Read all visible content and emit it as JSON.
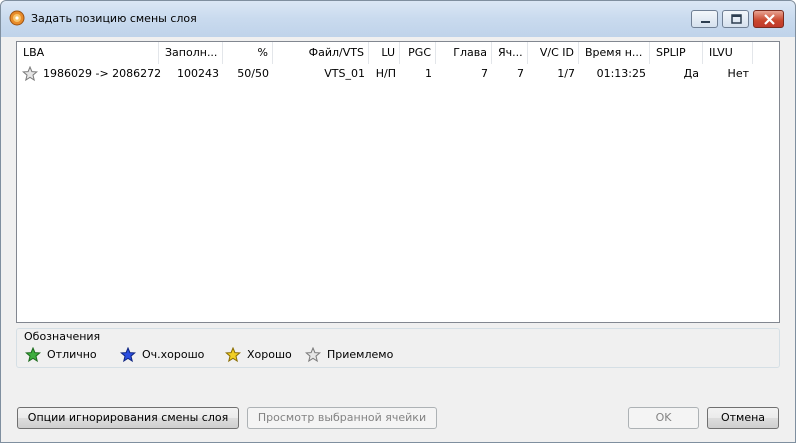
{
  "window": {
    "title": "Задать позицию смены слоя"
  },
  "list": {
    "columns": [
      {
        "label": "LBA"
      },
      {
        "label": "Заполн..."
      },
      {
        "label": "%"
      },
      {
        "label": "Файл/VTS"
      },
      {
        "label": "LU"
      },
      {
        "label": "PGC"
      },
      {
        "label": "Глава"
      },
      {
        "label": "Яч..."
      },
      {
        "label": "V/C ID"
      },
      {
        "label": "Время н..."
      },
      {
        "label": "SPLIP"
      },
      {
        "label": "ILVU"
      }
    ],
    "rows": [
      {
        "rating_icon": "gray-star-icon",
        "cells": [
          "1986029 -> 2086272",
          "100243",
          "50/50",
          "VTS_01",
          "Н/П",
          "1",
          "7",
          "7",
          "1/7",
          "01:13:25",
          "Да",
          "Нет"
        ]
      }
    ]
  },
  "legend": {
    "title": "Обозначения",
    "items": [
      {
        "label": "Отлично",
        "icon": "green-star-icon",
        "color": "#2e9e2e"
      },
      {
        "label": "Оч.хорошо",
        "icon": "blue-star-icon",
        "color": "#1f3fd1"
      },
      {
        "label": "Хорошо",
        "icon": "yellow-star-icon",
        "color": "#e8c21a"
      },
      {
        "label": "Приемлемо",
        "icon": "gray-star-icon",
        "color": "#b5b5b5"
      }
    ]
  },
  "buttons": {
    "ignore": "Опции игнорирования смены слоя",
    "view_cell": "Просмотр выбранной ячейки",
    "ok": "OK",
    "cancel": "Отмена"
  }
}
